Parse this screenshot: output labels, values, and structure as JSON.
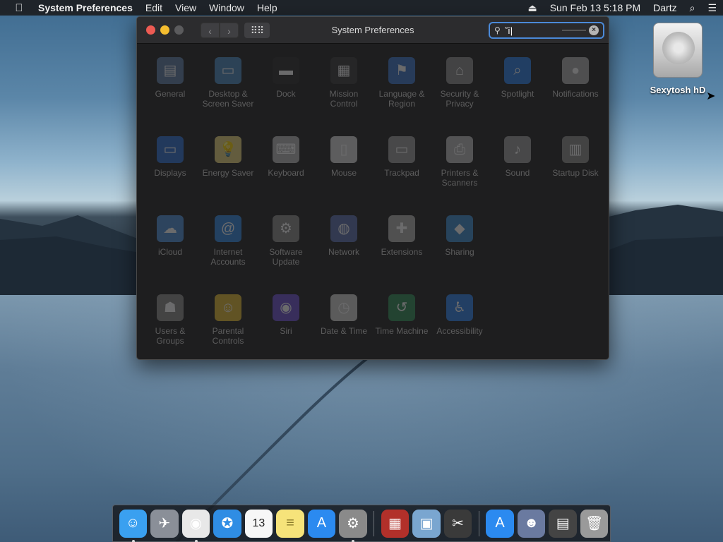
{
  "menubar": {
    "apple_icon": "apple-logo-icon",
    "app_name": "System Preferences",
    "menus": [
      "Edit",
      "View",
      "Window",
      "Help"
    ],
    "eject_icon": "eject-icon",
    "datetime": "Sun Feb 13  5:18 PM",
    "user": "Dartz",
    "search_icon": "spotlight-search-icon",
    "list_icon": "notification-center-icon"
  },
  "desktop": {
    "disk_label": "Sexytosh hD"
  },
  "window": {
    "title": "System Preferences",
    "back_glyph": "‹",
    "forward_glyph": "›",
    "grid_glyph": "⠿⠿",
    "search": {
      "value": "˜ī|",
      "icon": "magnifier-icon",
      "clear_glyph": "×"
    }
  },
  "panes": [
    [
      {
        "label": "General",
        "icon": "general-icon",
        "color": "#5e7fa6"
      },
      {
        "label": "Desktop & Screen Saver",
        "icon": "desktop-screensaver-icon",
        "color": "#4b8ac0"
      },
      {
        "label": "Dock",
        "icon": "dock-icon",
        "color": "#2b2b2b"
      },
      {
        "label": "Mission Control",
        "icon": "mission-control-icon",
        "color": "#3a3a3a"
      },
      {
        "label": "Language & Region",
        "icon": "language-region-icon",
        "color": "#3b76c9"
      },
      {
        "label": "Security & Privacy",
        "icon": "security-privacy-icon",
        "color": "#8e8e8e"
      },
      {
        "label": "Spotlight",
        "icon": "spotlight-icon",
        "color": "#2b7ee8"
      },
      {
        "label": "Notifications",
        "icon": "notifications-icon",
        "color": "#b0b0b0"
      }
    ],
    [
      {
        "label": "Displays",
        "icon": "displays-icon",
        "color": "#2c6fd1"
      },
      {
        "label": "Energy Saver",
        "icon": "energy-saver-icon",
        "color": "#e9d57a"
      },
      {
        "label": "Keyboard",
        "icon": "keyboard-icon",
        "color": "#b8b8b8"
      },
      {
        "label": "Mouse",
        "icon": "mouse-icon",
        "color": "#d8d8d8"
      },
      {
        "label": "Trackpad",
        "icon": "trackpad-icon",
        "color": "#9a9a9a"
      },
      {
        "label": "Printers & Scanners",
        "icon": "printers-scanners-icon",
        "color": "#bbbbbb"
      },
      {
        "label": "Sound",
        "icon": "sound-icon",
        "color": "#9a9a9a"
      },
      {
        "label": "Startup Disk",
        "icon": "startup-disk-icon",
        "color": "#8a8a8a"
      }
    ],
    [
      {
        "label": "iCloud",
        "icon": "icloud-icon",
        "color": "#4c8fd8"
      },
      {
        "label": "Internet Accounts",
        "icon": "internet-accounts-icon",
        "color": "#2d86e0"
      },
      {
        "label": "Software Update",
        "icon": "software-update-icon",
        "color": "#8a8a8a"
      },
      {
        "label": "Network",
        "icon": "network-icon",
        "color": "#5a6fb0"
      },
      {
        "label": "Extensions",
        "icon": "extensions-icon",
        "color": "#b0b0b0"
      },
      {
        "label": "Sharing",
        "icon": "sharing-icon",
        "color": "#3b8ad0"
      }
    ],
    [
      {
        "label": "Users & Groups",
        "icon": "users-groups-icon",
        "color": "#8a8a8a"
      },
      {
        "label": "Parental Controls",
        "icon": "parental-controls-icon",
        "color": "#e2b92e"
      },
      {
        "label": "Siri",
        "icon": "siri-icon",
        "color": "#6a4fd0"
      },
      {
        "label": "Date & Time",
        "icon": "date-time-icon",
        "color": "#d0d0d0"
      },
      {
        "label": "Time Machine",
        "icon": "time-machine-icon",
        "color": "#2f8a55"
      },
      {
        "label": "Accessibility",
        "icon": "accessibility-icon",
        "color": "#2b7ee8"
      }
    ]
  ],
  "dock": [
    {
      "name": "finder-icon",
      "color": "#3aa0f0",
      "glyph": "☺",
      "running": true
    },
    {
      "name": "launchpad-icon",
      "color": "#8a8f98",
      "glyph": "✈",
      "running": false
    },
    {
      "name": "chrome-icon",
      "color": "#e8e8e8",
      "glyph": "◉",
      "running": true
    },
    {
      "name": "safari-icon",
      "color": "#2f8de4",
      "glyph": "✪",
      "running": false
    },
    {
      "name": "calendar-icon",
      "color": "#f7f7f7",
      "glyph": "13",
      "running": false
    },
    {
      "name": "notes-icon",
      "color": "#f6e37a",
      "glyph": "≡",
      "running": false
    },
    {
      "name": "app-store-icon",
      "color": "#2b8af0",
      "glyph": "A",
      "running": false
    },
    {
      "name": "system-preferences-icon",
      "color": "#8a8a8a",
      "glyph": "⚙",
      "running": true
    },
    {
      "sep": true
    },
    {
      "name": "photo-booth-icon",
      "color": "#b2302a",
      "glyph": "▦",
      "running": false
    },
    {
      "name": "preview-icon",
      "color": "#7aa6d0",
      "glyph": "▣",
      "running": false
    },
    {
      "name": "script-editor-icon",
      "color": "#3a3a3a",
      "glyph": "✂",
      "running": false
    },
    {
      "sep": true
    },
    {
      "name": "app-store-download-icon",
      "color": "#2b8af0",
      "glyph": "A",
      "running": false
    },
    {
      "name": "anime-app-icon",
      "color": "#6a7aa0",
      "glyph": "☻",
      "running": false
    },
    {
      "name": "screenshot-stack-icon",
      "color": "#444",
      "glyph": "▤",
      "running": false
    },
    {
      "name": "trash-icon",
      "color": "#9a9a9a",
      "glyph": "🗑",
      "running": false
    }
  ]
}
